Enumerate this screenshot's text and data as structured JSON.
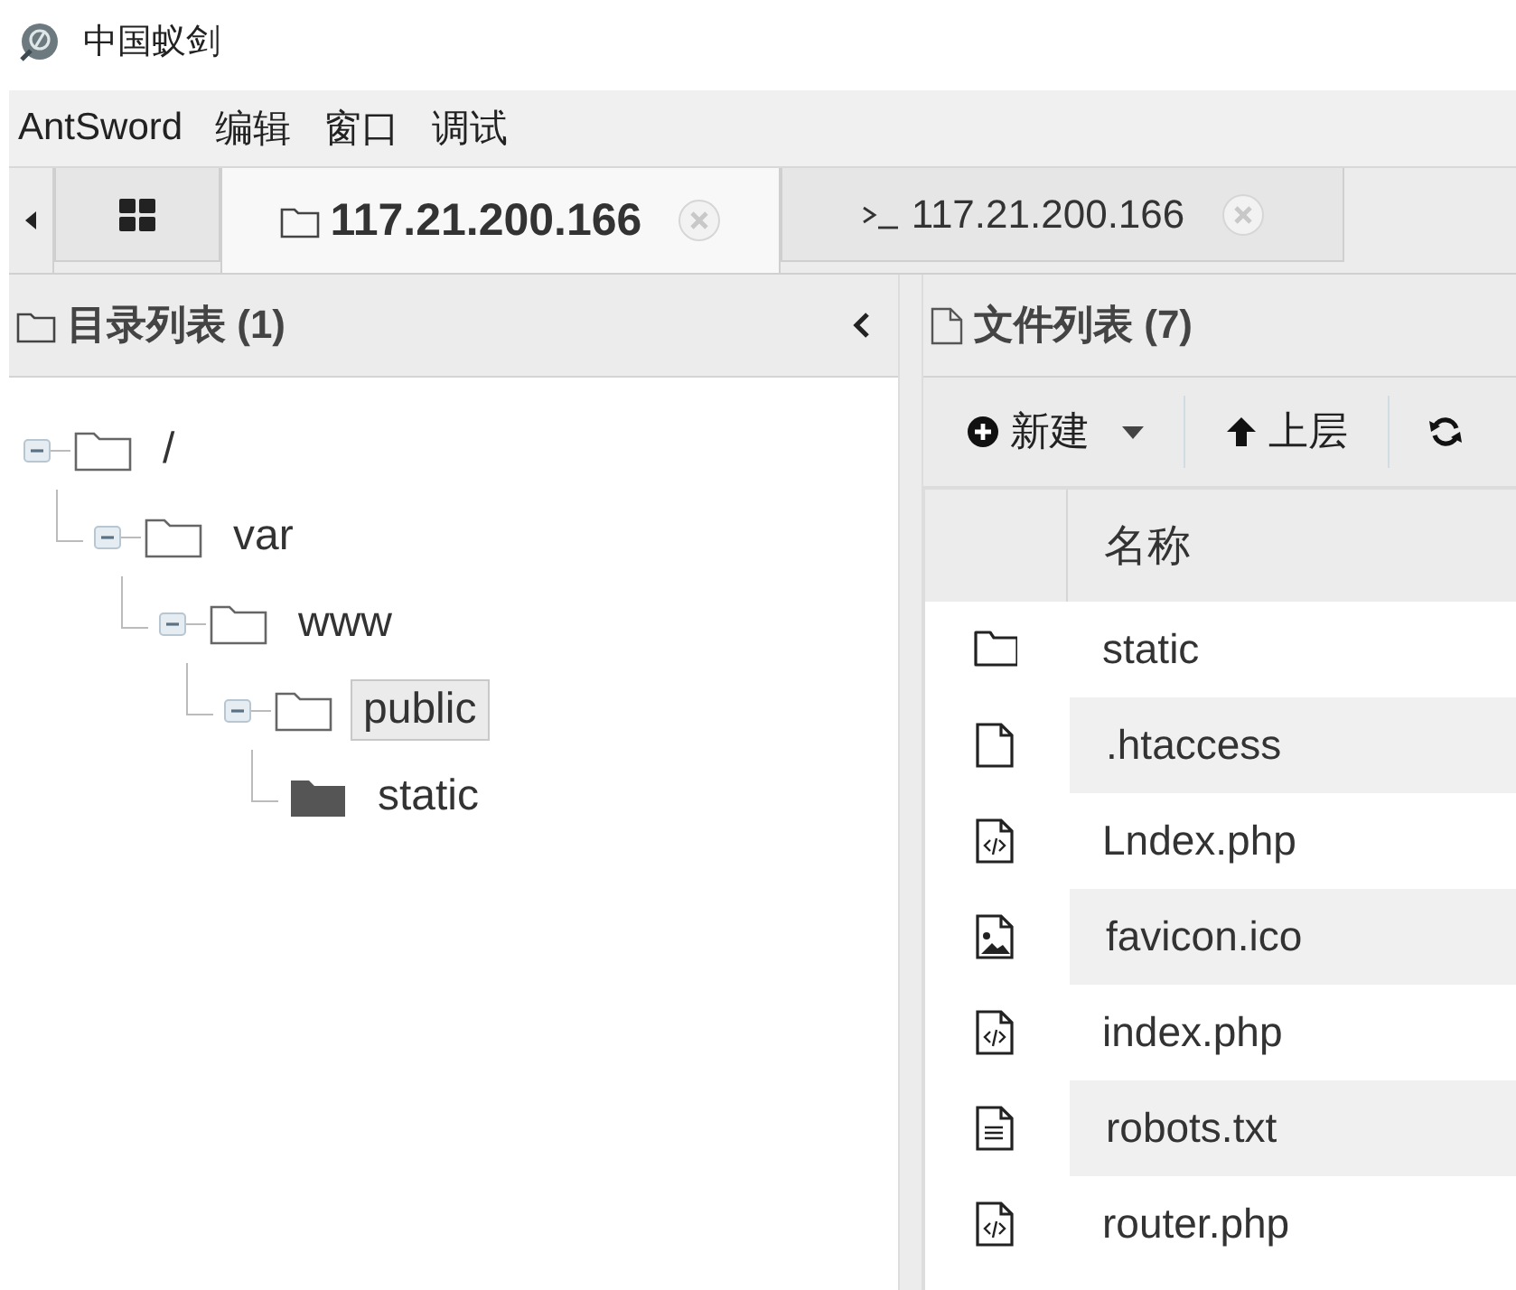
{
  "app": {
    "title": "中国蚁剑"
  },
  "menu": [
    "AntSword",
    "编辑",
    "窗口",
    "调试"
  ],
  "tabs": [
    {
      "kind": "grid",
      "selected": false
    },
    {
      "kind": "folder",
      "label": "117.21.200.166",
      "selected": true
    },
    {
      "kind": "terminal",
      "label": "117.21.200.166",
      "selected": false
    }
  ],
  "directory_panel": {
    "title": "目录列表 (1)",
    "tree": [
      {
        "name": "/",
        "expanded": true,
        "selected": false,
        "children": [
          {
            "name": "var",
            "expanded": true,
            "selected": false,
            "children": [
              {
                "name": "www",
                "expanded": true,
                "selected": false,
                "children": [
                  {
                    "name": "public",
                    "expanded": true,
                    "selected": true,
                    "children": [
                      {
                        "name": "static",
                        "selected": false
                      }
                    ]
                  }
                ]
              }
            ]
          }
        ]
      }
    ]
  },
  "file_panel": {
    "title": "文件列表 (7)",
    "toolbar": [
      {
        "kind": "new",
        "label": "新建"
      },
      {
        "kind": "up",
        "label": "上层"
      },
      {
        "kind": "refresh"
      }
    ],
    "columns": [
      "名称"
    ],
    "rows": [
      {
        "kind": "folder",
        "name": "static"
      },
      {
        "kind": "file",
        "name": ".htaccess"
      },
      {
        "kind": "code",
        "name": "Lndex.php"
      },
      {
        "kind": "image",
        "name": "favicon.ico"
      },
      {
        "kind": "code",
        "name": "index.php"
      },
      {
        "kind": "text",
        "name": "robots.txt"
      },
      {
        "kind": "code",
        "name": "router.php"
      }
    ]
  }
}
